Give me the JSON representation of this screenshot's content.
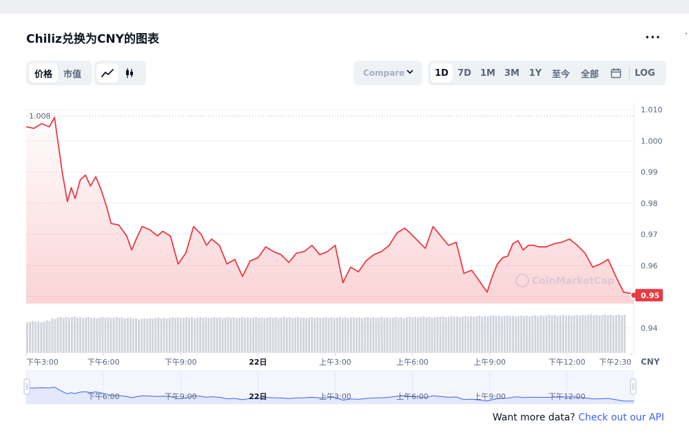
{
  "title": "Chiliz兑换为CNY的图表",
  "toolbar": {
    "metric_tabs": [
      {
        "label": "价格",
        "active": true
      },
      {
        "label": "市值",
        "active": false
      }
    ],
    "chart_style_icons": [
      "line-chart-icon",
      "candlestick-icon"
    ],
    "compare_label": "Compare",
    "range_tabs": [
      {
        "label": "1D",
        "active": true
      },
      {
        "label": "7D",
        "active": false
      },
      {
        "label": "1M",
        "active": false
      },
      {
        "label": "3M",
        "active": false
      },
      {
        "label": "1Y",
        "active": false
      },
      {
        "label": "至今",
        "active": false
      },
      {
        "label": "全部",
        "active": false
      }
    ],
    "calendar_icon": "calendar-icon",
    "log_label": "LOG",
    "more_icon": "more-dots-icon"
  },
  "footer": {
    "text": "Want more data?",
    "link": "Check out our API"
  },
  "colors": {
    "line": "#ea3943",
    "fill": "#ea3943",
    "link": "#3861fb",
    "volume": "#c3c8d0",
    "nav_line": "#3861fb",
    "nav_fill": "#e3e8fb"
  },
  "chart_data": {
    "type": "area",
    "currency_label": "CNY",
    "watermark": "CoinMarketCap",
    "max_label": "1.008",
    "current_label": "0.95",
    "yticks": [
      "1.010",
      "1.000",
      "0.99",
      "0.98",
      "0.97",
      "0.96",
      "0.95",
      "0.94"
    ],
    "ylim": [
      0.932,
      1.012
    ],
    "xlim": [
      0,
      23.6
    ],
    "xticks": [
      {
        "x": 0,
        "label": "下午3:00"
      },
      {
        "x": 3,
        "label": "下午6:00"
      },
      {
        "x": 6,
        "label": "下午9:00"
      },
      {
        "x": 9,
        "label": "22日"
      },
      {
        "x": 12,
        "label": "上午3:00"
      },
      {
        "x": 15,
        "label": "上午6:00"
      },
      {
        "x": 18,
        "label": "上午9:00"
      },
      {
        "x": 21,
        "label": "下午12:00"
      },
      {
        "x": 23.5,
        "label": "下午2:30"
      }
    ],
    "nav_labels": [
      {
        "x": 3,
        "label": "下午6:00"
      },
      {
        "x": 6,
        "label": "下午9:00"
      },
      {
        "x": 9,
        "label": "22日"
      },
      {
        "x": 12,
        "label": "上午3:00"
      },
      {
        "x": 15,
        "label": "上午6:00"
      },
      {
        "x": 18,
        "label": "上午9:00"
      },
      {
        "x": 21,
        "label": "下午12:00"
      }
    ],
    "x": [
      0,
      0.3,
      0.6,
      0.9,
      1.1,
      1.4,
      1.6,
      1.75,
      1.9,
      2.1,
      2.3,
      2.5,
      2.7,
      2.9,
      3.1,
      3.3,
      3.6,
      3.9,
      4.1,
      4.3,
      4.5,
      4.8,
      5.1,
      5.3,
      5.6,
      5.9,
      6.2,
      6.5,
      6.8,
      7.0,
      7.2,
      7.5,
      7.8,
      8.1,
      8.4,
      8.7,
      9.0,
      9.3,
      9.6,
      9.9,
      10.2,
      10.5,
      10.8,
      11.1,
      11.4,
      11.7,
      12.0,
      12.3,
      12.6,
      12.9,
      13.2,
      13.5,
      13.8,
      14.1,
      14.4,
      14.7,
      14.9,
      15.2,
      15.5,
      15.8,
      16.1,
      16.4,
      16.7,
      17.0,
      17.3,
      17.6,
      17.9,
      18.1,
      18.3,
      18.5,
      18.7,
      18.9,
      19.1,
      19.3,
      19.5,
      19.7,
      19.9,
      20.2,
      20.5,
      20.8,
      21.1,
      21.4,
      21.7,
      22.0,
      22.3,
      22.6,
      22.9,
      23.2,
      23.5,
      23.6
    ],
    "y": [
      1.0045,
      1.004,
      1.0055,
      1.0045,
      1.0075,
      0.99,
      0.9805,
      0.985,
      0.9815,
      0.9875,
      0.989,
      0.9855,
      0.9885,
      0.9845,
      0.9795,
      0.9735,
      0.973,
      0.9695,
      0.965,
      0.969,
      0.9725,
      0.9715,
      0.9695,
      0.971,
      0.9695,
      0.9605,
      0.964,
      0.9725,
      0.97,
      0.9665,
      0.9685,
      0.9665,
      0.9605,
      0.962,
      0.9565,
      0.9615,
      0.9625,
      0.966,
      0.9645,
      0.9635,
      0.961,
      0.964,
      0.9645,
      0.9665,
      0.9635,
      0.9645,
      0.9665,
      0.9545,
      0.9595,
      0.958,
      0.9615,
      0.9635,
      0.9645,
      0.9665,
      0.9705,
      0.972,
      0.9705,
      0.968,
      0.9655,
      0.9725,
      0.9695,
      0.9665,
      0.9675,
      0.9575,
      0.9585,
      0.955,
      0.9515,
      0.9565,
      0.9605,
      0.9625,
      0.963,
      0.967,
      0.968,
      0.965,
      0.9665,
      0.9665,
      0.966,
      0.966,
      0.967,
      0.9675,
      0.9685,
      0.9665,
      0.964,
      0.9595,
      0.9605,
      0.962,
      0.9565,
      0.9515,
      0.951,
      0.9505
    ],
    "volume": [
      0.72,
      0.73,
      0.72,
      0.74,
      0.8,
      0.82,
      0.83,
      0.83,
      0.82,
      0.82,
      0.81,
      0.82,
      0.82,
      0.82,
      0.82,
      0.81,
      0.8,
      0.79,
      0.8,
      0.81,
      0.81,
      0.81,
      0.82,
      0.82,
      0.82,
      0.82,
      0.82,
      0.82,
      0.82,
      0.82,
      0.82,
      0.82,
      0.82,
      0.82,
      0.82,
      0.82,
      0.82,
      0.82,
      0.82,
      0.82,
      0.82,
      0.82,
      0.82,
      0.82,
      0.82,
      0.82,
      0.82,
      0.82,
      0.82,
      0.82,
      0.82,
      0.82,
      0.82,
      0.82,
      0.82,
      0.82,
      0.82,
      0.83,
      0.83,
      0.83,
      0.83,
      0.83,
      0.84,
      0.84,
      0.84,
      0.84,
      0.85,
      0.85,
      0.85,
      0.86,
      0.86,
      0.86,
      0.86,
      0.86,
      0.86,
      0.86,
      0.86,
      0.87,
      0.87,
      0.87,
      0.87,
      0.87,
      0.87,
      0.88,
      0.88,
      0.88,
      0.88,
      0.88,
      0.88,
      0.88
    ]
  }
}
